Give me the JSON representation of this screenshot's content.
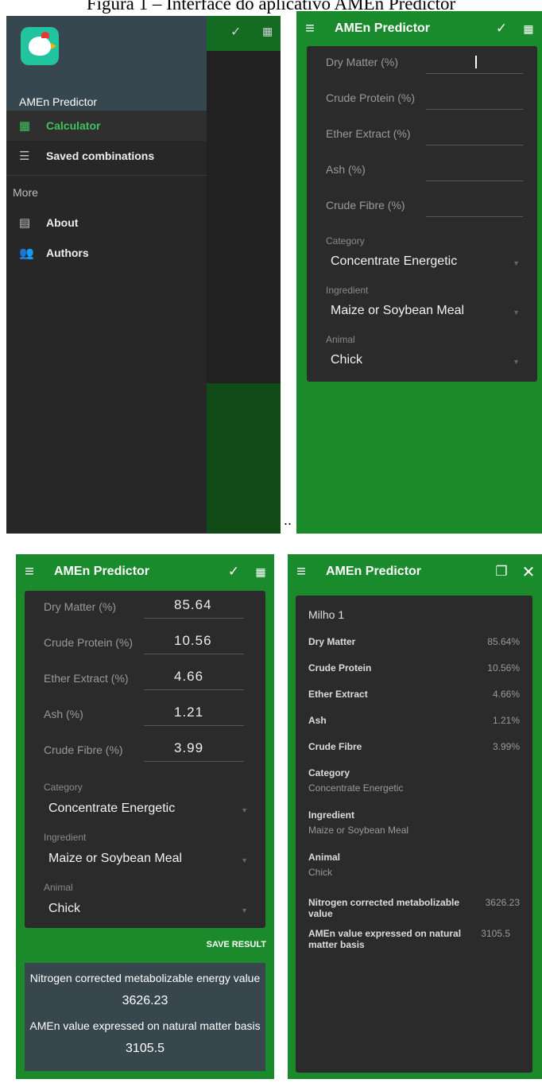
{
  "caption": "Figura 1 – Interface do aplicativo AMEn Predictor",
  "app": {
    "name": "AMEn Predictor"
  },
  "drawer": {
    "app_name": "AMEn Predictor",
    "items": [
      {
        "label": "Calculator",
        "icon": "calculator-icon",
        "active": true
      },
      {
        "label": "Saved combinations",
        "icon": "list-icon",
        "active": false
      }
    ],
    "section": "More",
    "more_items": [
      {
        "label": "About",
        "icon": "clipboard-icon"
      },
      {
        "label": "Authors",
        "icon": "people-icon"
      }
    ]
  },
  "form": {
    "fields": [
      {
        "label": "Dry Matter (%)",
        "value": "85.64"
      },
      {
        "label": "Crude Protein (%)",
        "value": "10.56"
      },
      {
        "label": "Ether Extract (%)",
        "value": "4.66"
      },
      {
        "label": "Ash (%)",
        "value": "1.21"
      },
      {
        "label": "Crude Fibre (%)",
        "value": "3.99"
      }
    ],
    "selects": [
      {
        "label": "Category",
        "value": "Concentrate Energetic"
      },
      {
        "label": "Ingredient",
        "value": "Maize or Soybean Meal"
      },
      {
        "label": "Animal",
        "value": "Chick"
      }
    ]
  },
  "save_label": "SAVE RESULT",
  "results": {
    "nitrogen_title": "Nitrogen corrected metabolizable energy value",
    "nitrogen_value": "3626.23",
    "natural_title": "AMEn value expressed on natural matter basis",
    "natural_value": "3105.5"
  },
  "detail": {
    "name": "Milho 1",
    "rows": [
      {
        "label": "Dry Matter",
        "value": "85.64%"
      },
      {
        "label": "Crude Protein",
        "value": "10.56%"
      },
      {
        "label": "Ether Extract",
        "value": "4.66%"
      },
      {
        "label": "Ash",
        "value": "1.21%"
      },
      {
        "label": "Crude Fibre",
        "value": "3.99%"
      }
    ],
    "category_label": "Category",
    "category_value": "Concentrate Energetic",
    "ingredient_label": "Ingredient",
    "ingredient_value": "Maize or Soybean Meal",
    "animal_label": "Animal",
    "animal_value": "Chick",
    "nitrogen_label": "Nitrogen corrected metabolizable value",
    "nitrogen_value": "3626.23",
    "natural_label": "AMEn value expressed on natural matter basis",
    "natural_value": "3105.5"
  },
  "colors": {
    "green": "#1a8b2c",
    "accent": "#3ec45c",
    "card": "#2b2b2b",
    "result_bg": "#38474e"
  },
  "icons": {
    "menu": "menu-icon",
    "clear": "broom-icon",
    "calc": "calculator-icon",
    "copy": "copy-icon",
    "close": "close-icon"
  }
}
